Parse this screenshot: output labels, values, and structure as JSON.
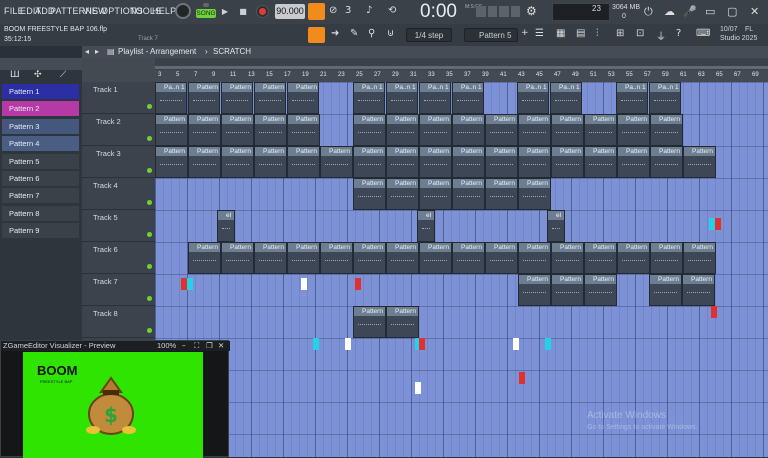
{
  "menu": [
    "FILE",
    "EDIT",
    "ADD",
    "PATTERNS",
    "VIEW",
    "OPTIONS",
    "TOOLS",
    "HELP"
  ],
  "transport": {
    "mode": "SONG",
    "tempo": "90.000",
    "time": "0:00",
    "time_unit": "M:S:CS",
    "cpu": "23",
    "memory": "3064 MB",
    "mem_sub": "0"
  },
  "project": {
    "name": "BOOM FREESTYLE BAP 106.flp",
    "position": "35:12:15",
    "track_hint": "Track 7"
  },
  "snap": "1/4 step",
  "current_pattern": "Pattern 5",
  "news": {
    "date": "10/07",
    "brand": "FL",
    "product": "Studio 2025"
  },
  "playlist": {
    "title": "Playlist - Arrangement",
    "sep": "›",
    "section": "SCRATCH"
  },
  "ruler": [
    "3",
    "5",
    "7",
    "9",
    "11",
    "13",
    "15",
    "17",
    "19",
    "21",
    "23",
    "25",
    "27",
    "29",
    "31",
    "33",
    "35",
    "37",
    "39",
    "41",
    "43",
    "45",
    "47",
    "49",
    "51",
    "53",
    "55",
    "57",
    "59",
    "61",
    "63",
    "65",
    "67",
    "69"
  ],
  "patterns": [
    {
      "label": "Pattern 1",
      "color": "#2b2fa3"
    },
    {
      "label": "Pattern 2",
      "color": "#b63aa5"
    },
    {
      "label": "Pattern 3",
      "color": "#45577c"
    },
    {
      "label": "Pattern 4",
      "color": "#4a5e84"
    },
    {
      "label": "Pattern 5",
      "color": "#3b4149"
    },
    {
      "label": "Pattern 6",
      "color": "#3b4149"
    },
    {
      "label": "Pattern 7",
      "color": "#3b4149"
    },
    {
      "label": "Pattern 8",
      "color": "#3b4149"
    },
    {
      "label": "Pattern 9",
      "color": "#3b4149"
    }
  ],
  "tracks": [
    "Track 1",
    "Track 2",
    "Track 3",
    "Track 4",
    "Track 5",
    "Track 6",
    "Track 7",
    "Track 8"
  ],
  "clip_labels": {
    "p1": "Pattern 1",
    "p1s": "Pa..n 1",
    "p5": "Pattern 5",
    "p6": "Pattern 6",
    "p7": "Pattern 7",
    "p8": "Pattern 8",
    "p9": "Pattern 9",
    "el": "el"
  },
  "visualizer": {
    "title": "ZGameEditor Visualizer - Preview",
    "zoom": "100%",
    "logo_title": "BOOM",
    "logo_sub": "FREESTYLE BAP"
  },
  "watermark": {
    "title": "Activate Windows",
    "sub": "Go to Settings to activate Windows."
  },
  "colors": {
    "grid": "#7d92d6",
    "clip_head": "#6e7e92",
    "clip_body": "#3d4756",
    "accent": "#f08b1c"
  }
}
